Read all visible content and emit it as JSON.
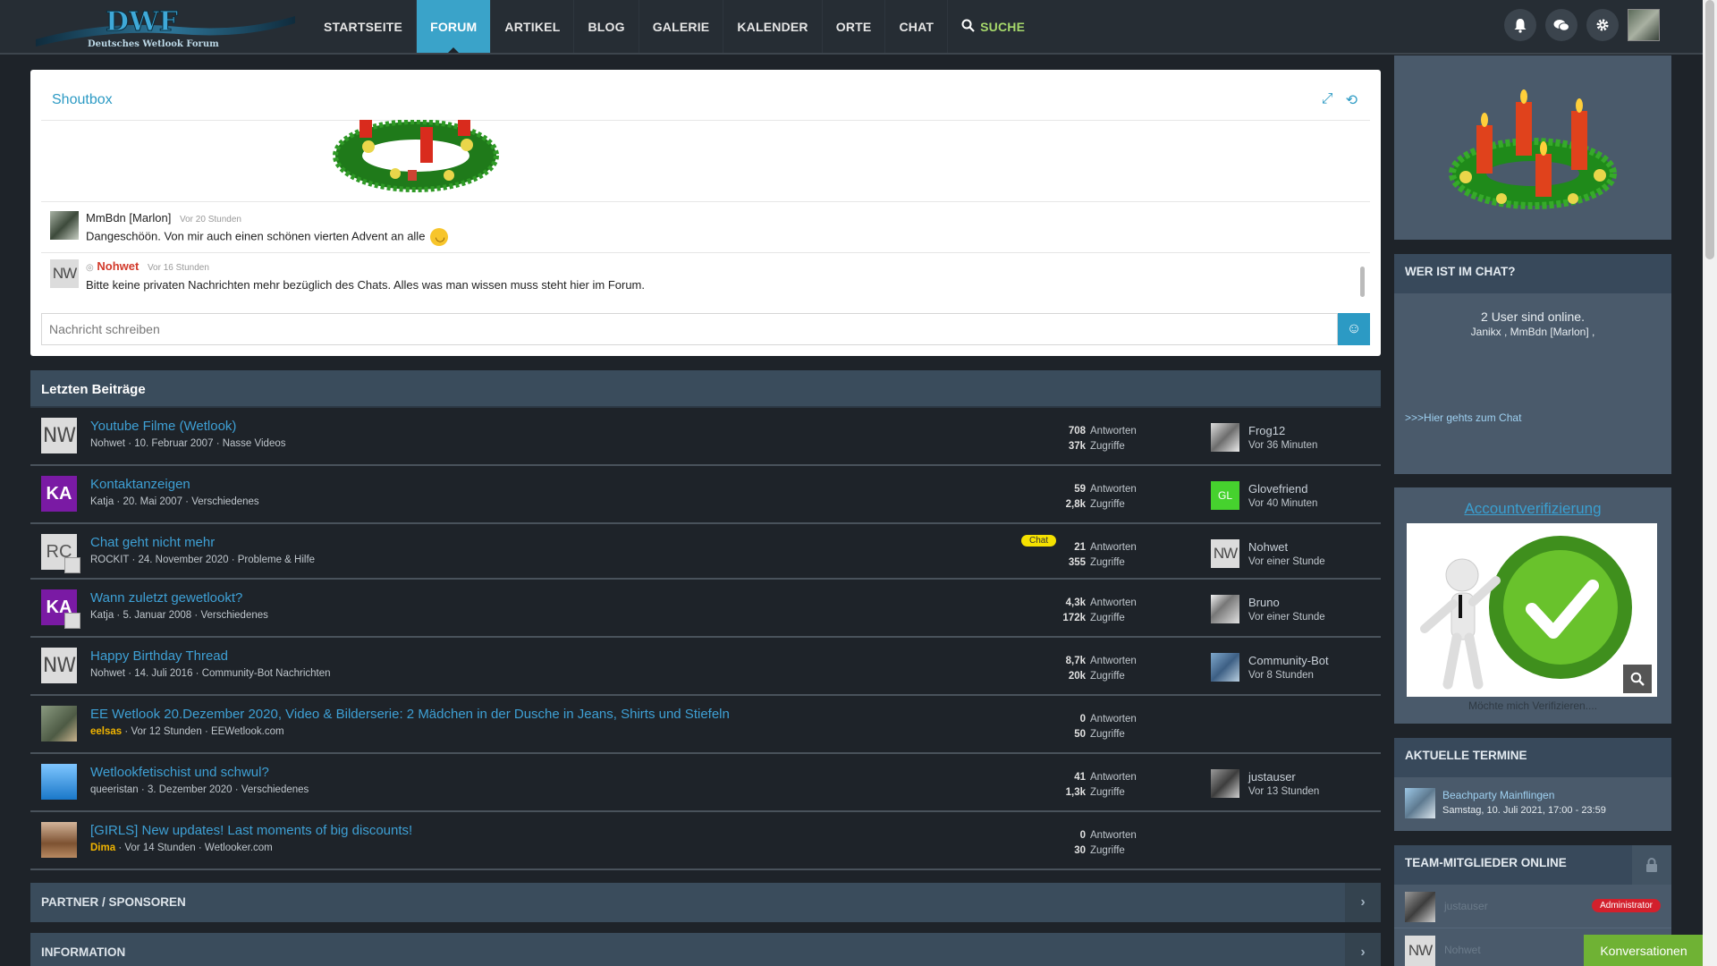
{
  "header": {
    "logo_text": "DWF",
    "logo_subtitle": "Deutsches Wetlook Forum",
    "nav": [
      {
        "label": "STARTSEITE"
      },
      {
        "label": "FORUM"
      },
      {
        "label": "ARTIKEL"
      },
      {
        "label": "BLOG"
      },
      {
        "label": "GALERIE"
      },
      {
        "label": "KALENDER"
      },
      {
        "label": "ORTE"
      },
      {
        "label": "CHAT"
      },
      {
        "label": "SUCHE"
      }
    ],
    "active_nav": "FORUM",
    "icons": [
      "bell-icon",
      "chat-bubbles-icon",
      "gear-icon"
    ]
  },
  "shoutbox": {
    "title": "Shoutbox",
    "messages": [
      {
        "author": "MmBdn [Marlon]",
        "time": "Vor 20 Stunden",
        "text": "Dangeschöön. Von mir auch einen schönen vierten Advent an alle"
      },
      {
        "author": "Nohwet",
        "time": "Vor 16 Stunden",
        "text": "Bitte keine privaten Nachrichten mehr bezüglich des Chats. Alles was man wissen muss steht hier im Forum.",
        "avatar_text": "NW"
      }
    ],
    "input_placeholder": "Nachricht schreiben"
  },
  "latest_posts": {
    "title": "Letzten Beiträge",
    "rows": [
      {
        "avatar": "NW",
        "title": "Youtube Filme (Wetlook)",
        "author": "Nohwet",
        "date": "10. Februar 2007",
        "forum": "Nasse Videos",
        "replies": "708",
        "views": "37k",
        "last_user": "Frog12",
        "last_time": "Vor 36 Minuten"
      },
      {
        "avatar": "KA",
        "title": "Kontaktanzeigen",
        "author": "Katja",
        "date": "20. Mai 2007",
        "forum": "Verschiedenes",
        "replies": "59",
        "views": "2,8k",
        "last_user": "Glovefriend",
        "last_time": "Vor 40 Minuten",
        "last_avatar": "GL"
      },
      {
        "avatar": "RC",
        "title": "Chat geht nicht mehr",
        "author": "ROCKIT",
        "date": "24. November 2020",
        "forum": "Probleme & Hilfe",
        "replies": "21",
        "views": "355",
        "last_user": "Nohwet",
        "last_time": "Vor einer Stunde",
        "tag": "Chat",
        "last_avatar": "NW"
      },
      {
        "avatar": "KA",
        "title": "Wann zuletzt gewetlookt?",
        "author": "Katja",
        "date": "5. Januar 2008",
        "forum": "Verschiedenes",
        "replies": "4,3k",
        "views": "172k",
        "last_user": "Bruno",
        "last_time": "Vor einer Stunde"
      },
      {
        "avatar": "NW",
        "title": "Happy Birthday Thread",
        "author": "Nohwet",
        "date": "14. Juli 2016",
        "forum": "Community-Bot Nachrichten",
        "replies": "8,7k",
        "views": "20k",
        "last_user": "Community-Bot",
        "last_time": "Vor 8 Stunden"
      },
      {
        "avatar": "",
        "title": "EE Wetlook 20.Dezember 2020, Video & Bilderserie: 2 Mädchen in der Dusche in Jeans, Shirts und Stiefeln",
        "author": "eelsas",
        "date": "Vor 12 Stunden",
        "forum": "EEWetlook.com",
        "replies": "0",
        "views": "50",
        "last_user": "",
        "last_time": ""
      },
      {
        "avatar": "",
        "title": "Wetlookfetischist und schwul?",
        "author": "queeristan",
        "date": "3. Dezember 2020",
        "forum": "Verschiedenes",
        "replies": "41",
        "views": "1,3k",
        "last_user": "justauser",
        "last_time": "Vor 13 Stunden"
      },
      {
        "avatar": "",
        "title": "[GIRLS] New updates! Last moments of big discounts!",
        "author": "Dima",
        "date": "Vor 14 Stunden",
        "forum": "Wetlooker.com",
        "replies": "0",
        "views": "30",
        "last_user": "",
        "last_time": ""
      }
    ],
    "replies_label": "Antworten",
    "views_label": "Zugriffe",
    "sep": "·"
  },
  "sections": [
    {
      "label": "PARTNER / SPONSOREN"
    },
    {
      "label": "INFORMATION"
    }
  ],
  "sidebar": {
    "chat": {
      "title": "WER IST IM CHAT?",
      "online_text": "2 User sind online.",
      "users_text": "Janikx , MmBdn [Marlon] ,",
      "link": ">>>Hier gehts zum Chat"
    },
    "verify": {
      "title": "Accountverifizierung",
      "caption": "Möchte mich Verifizieren...."
    },
    "events": {
      "title": "AKTUELLE TERMINE",
      "event_title": "Beachparty Mainflingen",
      "event_date": "Samstag, 10. Juli 2021, 17:00 - 23:59"
    },
    "team": {
      "title": "TEAM-MITGLIEDER ONLINE",
      "members": [
        {
          "name": "justauser",
          "badge": "Administrator"
        },
        {
          "name": "Nohwet",
          "avatar_text": "NW"
        }
      ]
    }
  },
  "conversations_button": "Konversationen",
  "colors": {
    "accent": "#3aa3c9",
    "link": "#3ea0d5",
    "header_bar": "#3a4c5c",
    "background": "#1e2329",
    "admin_badge": "#d3202c",
    "convo_button": "#6fb234"
  }
}
